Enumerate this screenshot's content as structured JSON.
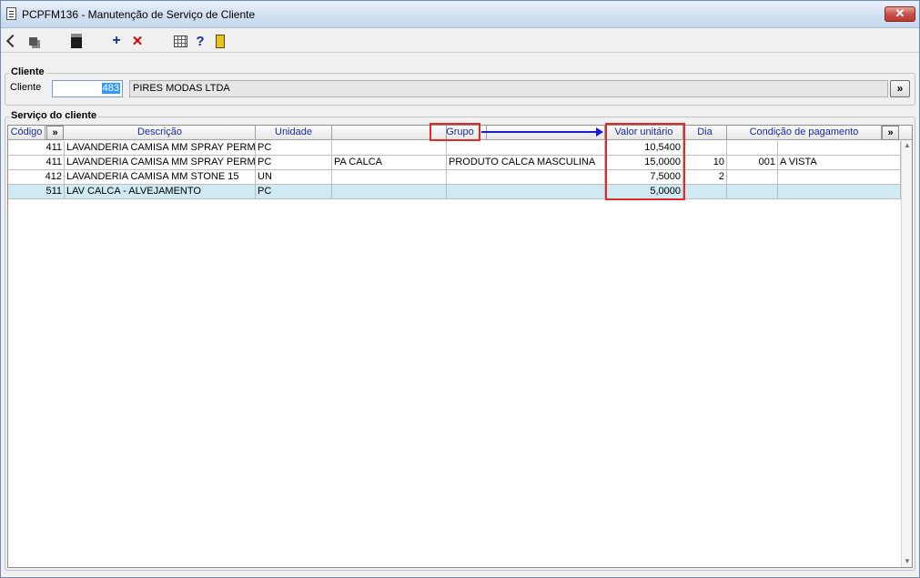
{
  "window": {
    "title": "PCPFM136 - Manutenção de Serviço de Cliente",
    "close_glyph": "✕"
  },
  "toolbar": {
    "add_glyph": "+",
    "delete_glyph": "✕",
    "help_glyph": "?",
    "icons": [
      "export-icon",
      "copy-icon",
      "save-icon",
      "add-icon",
      "delete-icon",
      "grid-icon",
      "help-icon",
      "exit-icon"
    ]
  },
  "cliente": {
    "group_label": "Cliente",
    "field_label": "Cliente",
    "code": "483",
    "name": "PIRES MODAS LTDA",
    "more_button": "»"
  },
  "servico": {
    "group_label": "Serviço do cliente",
    "columns": [
      "Código",
      "»",
      "Descrição",
      "Unidade",
      "",
      "Grupo",
      "",
      "Valor unitário",
      "Dia",
      "Condição de pagamento",
      "",
      "»"
    ],
    "rows": [
      {
        "codigo": "411",
        "descricao": "LAVANDERIA CAMISA MM SPRAY PERMAN",
        "unidade": "PC",
        "c4": "",
        "grupo": "",
        "valor": "10,5400",
        "dia": "",
        "cond_cod": "",
        "cond_desc": ""
      },
      {
        "codigo": "411",
        "descricao": "LAVANDERIA CAMISA MM SPRAY PERMAN",
        "unidade": "PC",
        "c4": "PA CALCA",
        "grupo": "PRODUTO CALCA MASCULINA",
        "valor": "15,0000",
        "dia": "10",
        "cond_cod": "001",
        "cond_desc": "A VISTA"
      },
      {
        "codigo": "412",
        "descricao": "LAVANDERIA CAMISA MM STONE 15",
        "unidade": "UN",
        "c4": "",
        "grupo": "",
        "valor": "7,5000",
        "dia": "2",
        "cond_cod": "",
        "cond_desc": ""
      },
      {
        "codigo": "511",
        "descricao": "LAV CALCA - ALVEJAMENTO",
        "unidade": "PC",
        "c4": "",
        "grupo": "",
        "valor": "5,0000",
        "dia": "",
        "cond_cod": "",
        "cond_desc": ""
      }
    ],
    "selected_row": 3,
    "scroll_up": "▲",
    "scroll_down": "▼"
  },
  "colors": {
    "header_text": "#1a2a9c",
    "highlight_box": "#e02a2a",
    "annotation_arrow": "#1c1cd8",
    "selected_row": "#cfeaf3"
  }
}
